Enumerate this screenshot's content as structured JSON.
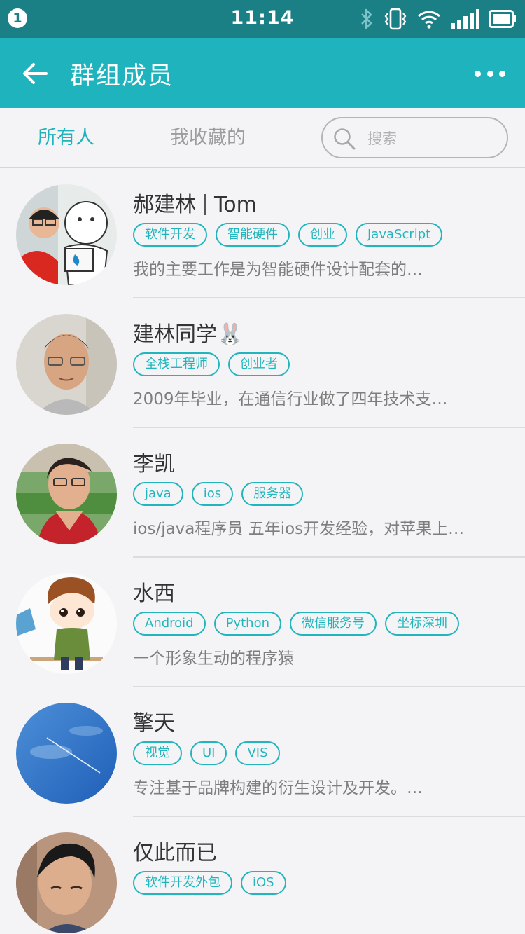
{
  "status_bar": {
    "notification_count": "1",
    "time": "11:14",
    "icons": [
      "bluetooth-icon",
      "vibrate-icon",
      "wifi-icon",
      "signal-icon",
      "battery-icon"
    ]
  },
  "app_bar": {
    "title": "群组成员",
    "back_icon": "arrow-left-icon",
    "more_icon": "more-horizontal-icon"
  },
  "tabs": {
    "all": "所有人",
    "favorites": "我收藏的",
    "active": "all"
  },
  "search": {
    "placeholder": "搜索"
  },
  "colors": {
    "status_bar": "#1b7f86",
    "app_bar": "#1fb3bd",
    "accent": "#21b6be",
    "background": "#f4f4f6"
  },
  "members": [
    {
      "name": "郝建林",
      "name_suffix": "Tom",
      "tags": [
        "软件开发",
        "智能硬件",
        "创业",
        "JavaScript"
      ],
      "bio": "我的主要工作是为智能硬件设计配套的…"
    },
    {
      "name": "建林同学🐰",
      "tags": [
        "全栈工程师",
        "创业者"
      ],
      "bio": "2009年毕业，在通信行业做了四年技术支…"
    },
    {
      "name": "李凯",
      "tags": [
        "java",
        "ios",
        "服务器"
      ],
      "bio": "ios/java程序员 五年ios开发经验，对苹果上…"
    },
    {
      "name": "水西",
      "tags": [
        "Android",
        "Python",
        "微信服务号",
        "坐标深圳"
      ],
      "bio": "一个形象生动的程序猿"
    },
    {
      "name": "擎天",
      "tags": [
        "视觉",
        "UI",
        "VIS"
      ],
      "bio": "专注基于品牌构建的衍生设计及开发。…"
    },
    {
      "name": "仅此而已",
      "tags": [
        "软件开发外包",
        "iOS"
      ],
      "bio": ""
    }
  ]
}
